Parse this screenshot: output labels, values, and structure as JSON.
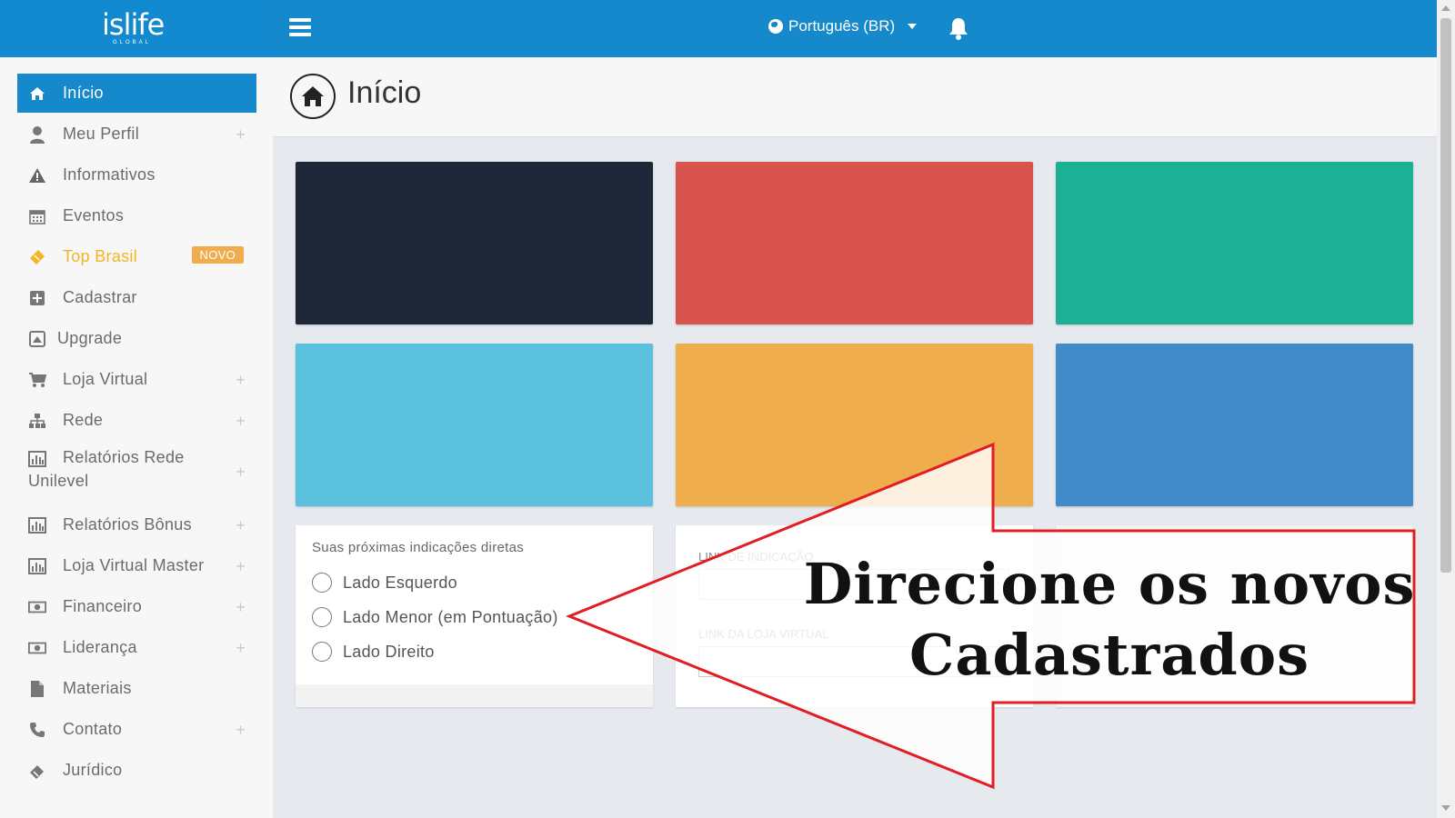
{
  "header": {
    "logo_text": "islife",
    "logo_sub": "GLOBAL",
    "language": "Português (BR)"
  },
  "sidebar": {
    "items": [
      {
        "label": "Início",
        "icon": "home-icon",
        "active": true
      },
      {
        "label": "Meu Perfil",
        "icon": "user-icon",
        "expandable": true
      },
      {
        "label": "Informativos",
        "icon": "warning-icon"
      },
      {
        "label": "Eventos",
        "icon": "calendar-icon"
      },
      {
        "label": "Top Brasil",
        "icon": "ticket-icon",
        "badge": "NOVO"
      },
      {
        "label": "Cadastrar",
        "icon": "plus-square-icon"
      },
      {
        "label": "Upgrade",
        "icon": "upgrade-icon"
      },
      {
        "label": "Loja Virtual",
        "icon": "cart-icon",
        "expandable": true
      },
      {
        "label": "Rede",
        "icon": "sitemap-icon",
        "expandable": true
      },
      {
        "label_line1": "Relatórios Rede",
        "label_line2": "Unilevel",
        "icon": "bar-chart-icon",
        "expandable": true
      },
      {
        "label": "Relatórios Bônus",
        "icon": "bar-chart-icon",
        "expandable": true
      },
      {
        "label": "Loja Virtual Master",
        "icon": "bar-chart-icon",
        "expandable": true
      },
      {
        "label": "Financeiro",
        "icon": "money-icon",
        "expandable": true
      },
      {
        "label": "Liderança",
        "icon": "money-icon",
        "expandable": true
      },
      {
        "label": "Materiais",
        "icon": "file-icon"
      },
      {
        "label": "Contato",
        "icon": "phone-icon",
        "expandable": true
      },
      {
        "label": "Jurídico",
        "icon": "gavel-icon"
      }
    ],
    "plus_symbol": "+"
  },
  "page": {
    "title": "Início"
  },
  "tiles": {
    "colors": [
      "#1e2738",
      "#d9534f",
      "#1cb195",
      "#5bc0de",
      "#f0ad4e",
      "#428bca"
    ]
  },
  "referral_panel": {
    "title": "Suas próximas indicações diretas",
    "options": [
      "Lado Esquerdo",
      "Lado Menor (em Pontuação)",
      "Lado Direito"
    ]
  },
  "links_panel": {
    "referral_label": "LINK DE INDICAÇÃO",
    "store_label": "LINK DA LOJA VIRTUAL"
  },
  "annotation": {
    "line1": "Direcione os novos",
    "line2": "Cadastrados",
    "arrow_color": "#e01e24"
  }
}
